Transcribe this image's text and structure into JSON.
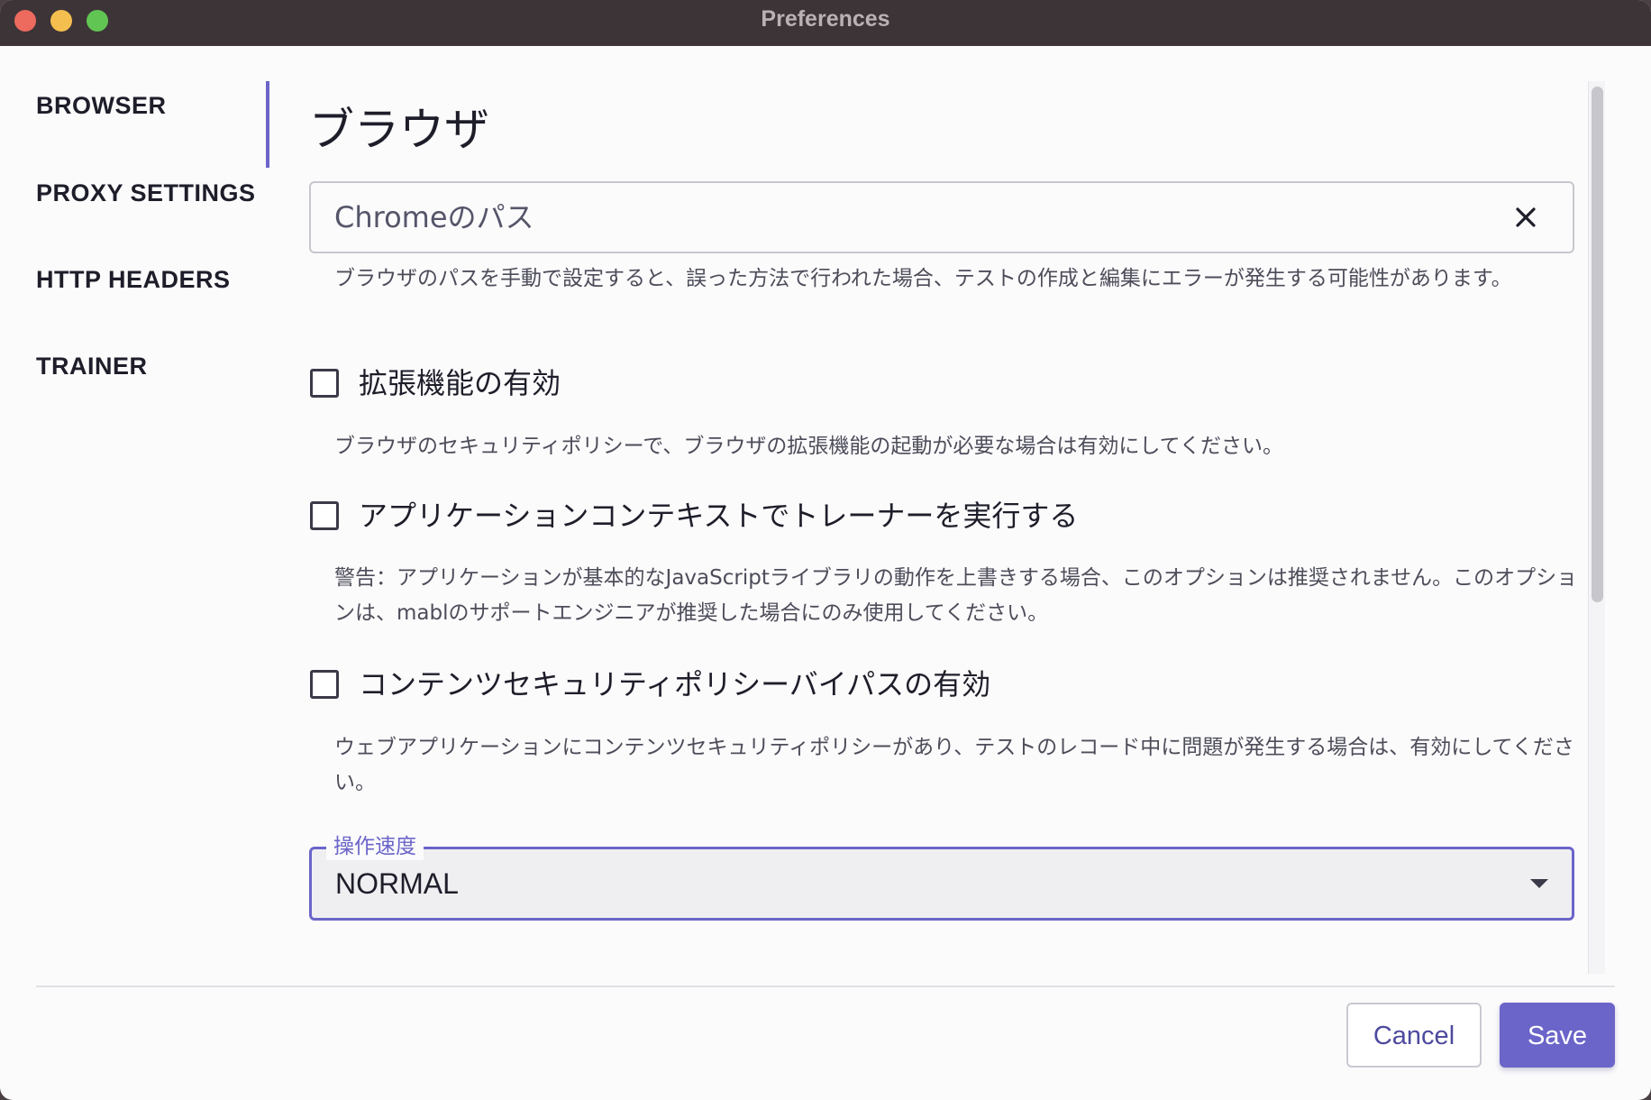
{
  "window": {
    "title": "Preferences"
  },
  "sidebar": {
    "items": [
      {
        "label": "BROWSER",
        "active": true
      },
      {
        "label": "PROXY SETTINGS",
        "active": false
      },
      {
        "label": "HTTP HEADERS",
        "active": false
      },
      {
        "label": "TRAINER",
        "active": false
      }
    ]
  },
  "main": {
    "title": "ブラウザ",
    "chrome_path": {
      "placeholder": "Chromeのパス",
      "value": "",
      "clear_icon": "close-icon",
      "helper": "ブラウザのパスを手動で設定すると、誤った方法で行われた場合、テストの作成と編集にエラーが発生する可能性があります。"
    },
    "enable_extensions": {
      "label": "拡張機能の有効",
      "checked": false,
      "helper": "ブラウザのセキュリティポリシーで、ブラウザの拡張機能の起動が必要な場合は有効にしてください。"
    },
    "trainer_app_context": {
      "label": "アプリケーションコンテキストでトレーナーを実行する",
      "checked": false,
      "helper": "警告：アプリケーションが基本的なJavaScriptライブラリの動作を上書きする場合、このオプションは推奨されません。このオプションは、mablのサポートエンジニアが推奨した場合にのみ使用してください。"
    },
    "csp_bypass": {
      "label": "コンテンツセキュリティポリシーバイパスの有効",
      "checked": false,
      "helper": "ウェブアプリケーションにコンテンツセキュリティポリシーがあり、テストのレコード中に問題が発生する場合は、有効にしてください。"
    },
    "operation_speed": {
      "label": "操作速度",
      "value": "NORMAL"
    }
  },
  "footer": {
    "cancel_label": "Cancel",
    "save_label": "Save"
  },
  "colors": {
    "accent": "#6b65c9",
    "titlebar": "#3d3437",
    "background": "#fbfbfc"
  }
}
